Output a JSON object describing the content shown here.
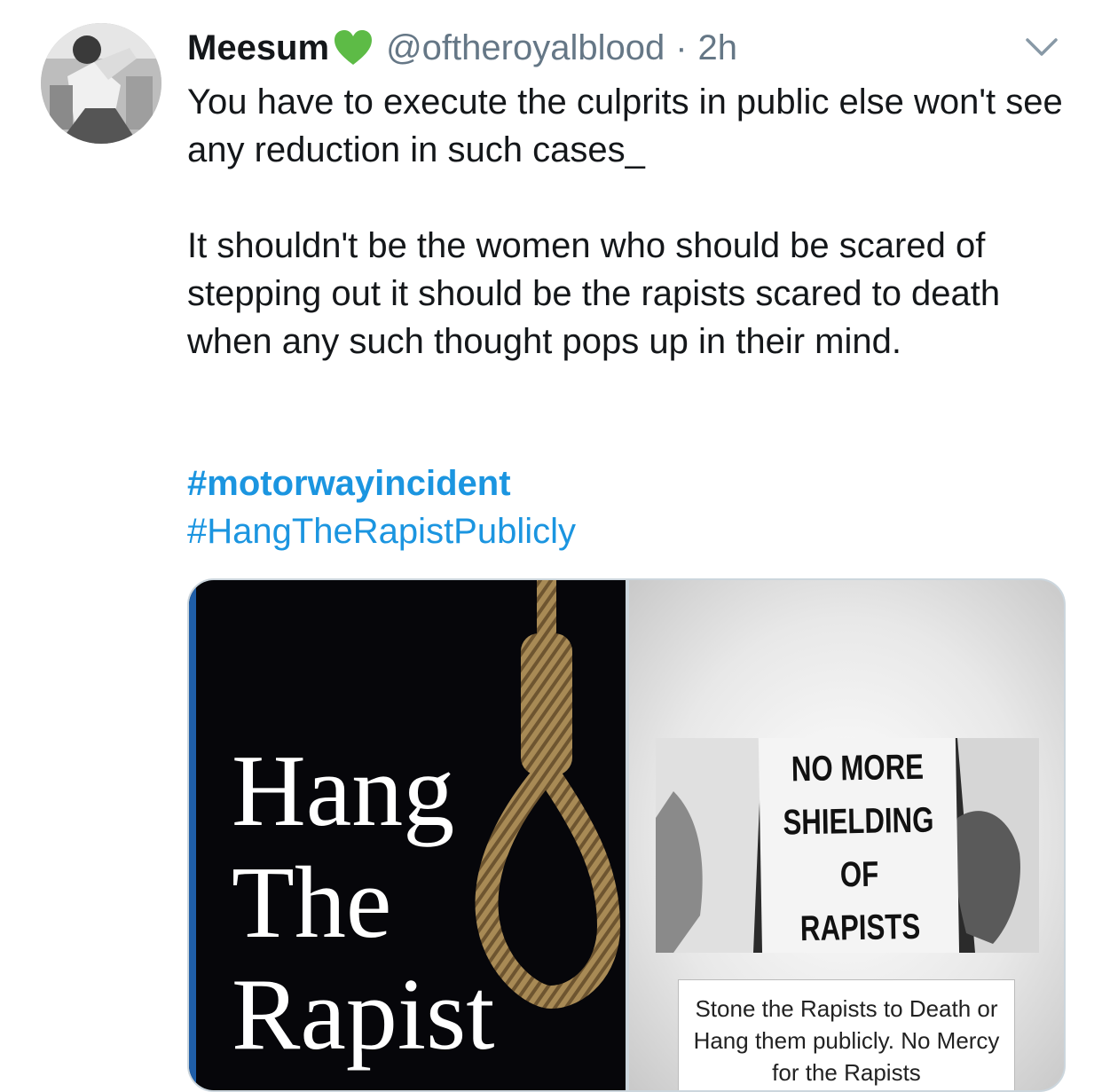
{
  "tweet": {
    "display_name": "Meesum",
    "handle": "@oftheroyalblood",
    "separator": "·",
    "time": "2h",
    "paragraph1": "You have to execute the culprits in public else won't see any reduction in such cases_",
    "paragraph2": "It shouldn't be the women who should be scared of stepping out it should be the rapists scared to death when any such thought pops up in their mind.",
    "hashtags": [
      "#motorwayincident",
      "#HangTheRapistPublicly"
    ]
  },
  "media": {
    "left_poster": {
      "words": [
        "Hang",
        "The",
        "Rapist"
      ]
    },
    "right_poster": {
      "sign_lines": [
        "NO MORE",
        "SHIELDING",
        "OF",
        "RAPISTS"
      ],
      "caption": "Stone the Rapists to Death or Hang them publicly. No Mercy for the Rapists"
    }
  },
  "icons": {
    "verified_like": "green-heart-icon",
    "menu": "chevron-down-icon"
  },
  "colors": {
    "link": "#1b95e0",
    "secondary_text": "#657786",
    "heart": "#5dbb46",
    "border": "#ccd6dd"
  }
}
